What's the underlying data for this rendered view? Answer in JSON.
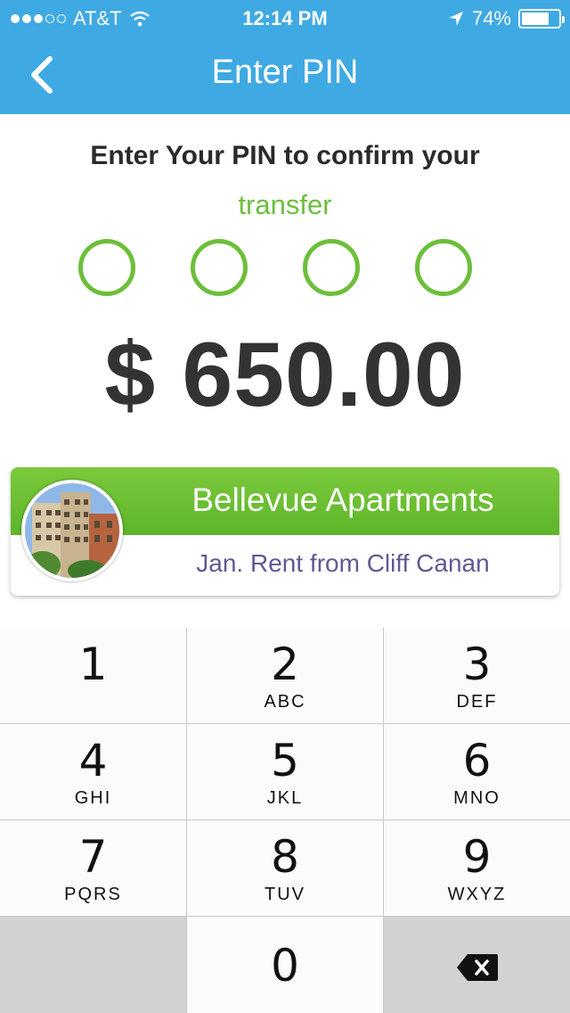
{
  "status_bar": {
    "carrier": "AT&T",
    "time": "12:14 PM",
    "battery_percent_label": "74%",
    "battery_level": 0.74,
    "icons": [
      "signal-dots-icon",
      "wifi-icon",
      "location-arrow-icon",
      "battery-icon"
    ]
  },
  "nav": {
    "title": "Enter PIN",
    "back_icon": "chevron-left-icon"
  },
  "prompt": {
    "line1": "Enter Your PIN to confirm your",
    "line2": "transfer"
  },
  "pin": {
    "length": 4,
    "filled": 0
  },
  "amount": "$ 650.00",
  "payee": {
    "name": "Bellevue Apartments",
    "note": "Jan. Rent from Cliff Canan",
    "avatar_icon": "apartment-building-photo"
  },
  "keypad": {
    "keys": [
      {
        "num": "1",
        "letters": ""
      },
      {
        "num": "2",
        "letters": "ABC"
      },
      {
        "num": "3",
        "letters": "DEF"
      },
      {
        "num": "4",
        "letters": "GHI"
      },
      {
        "num": "5",
        "letters": "JKL"
      },
      {
        "num": "6",
        "letters": "MNO"
      },
      {
        "num": "7",
        "letters": "PQRS"
      },
      {
        "num": "8",
        "letters": "TUV"
      },
      {
        "num": "9",
        "letters": "WXYZ"
      },
      {
        "num": "0",
        "letters": ""
      }
    ],
    "delete_icon": "backspace-icon"
  },
  "colors": {
    "header": "#3fa9e3",
    "accent_green": "#6cbf3a",
    "note_purple": "#5e5a93"
  }
}
